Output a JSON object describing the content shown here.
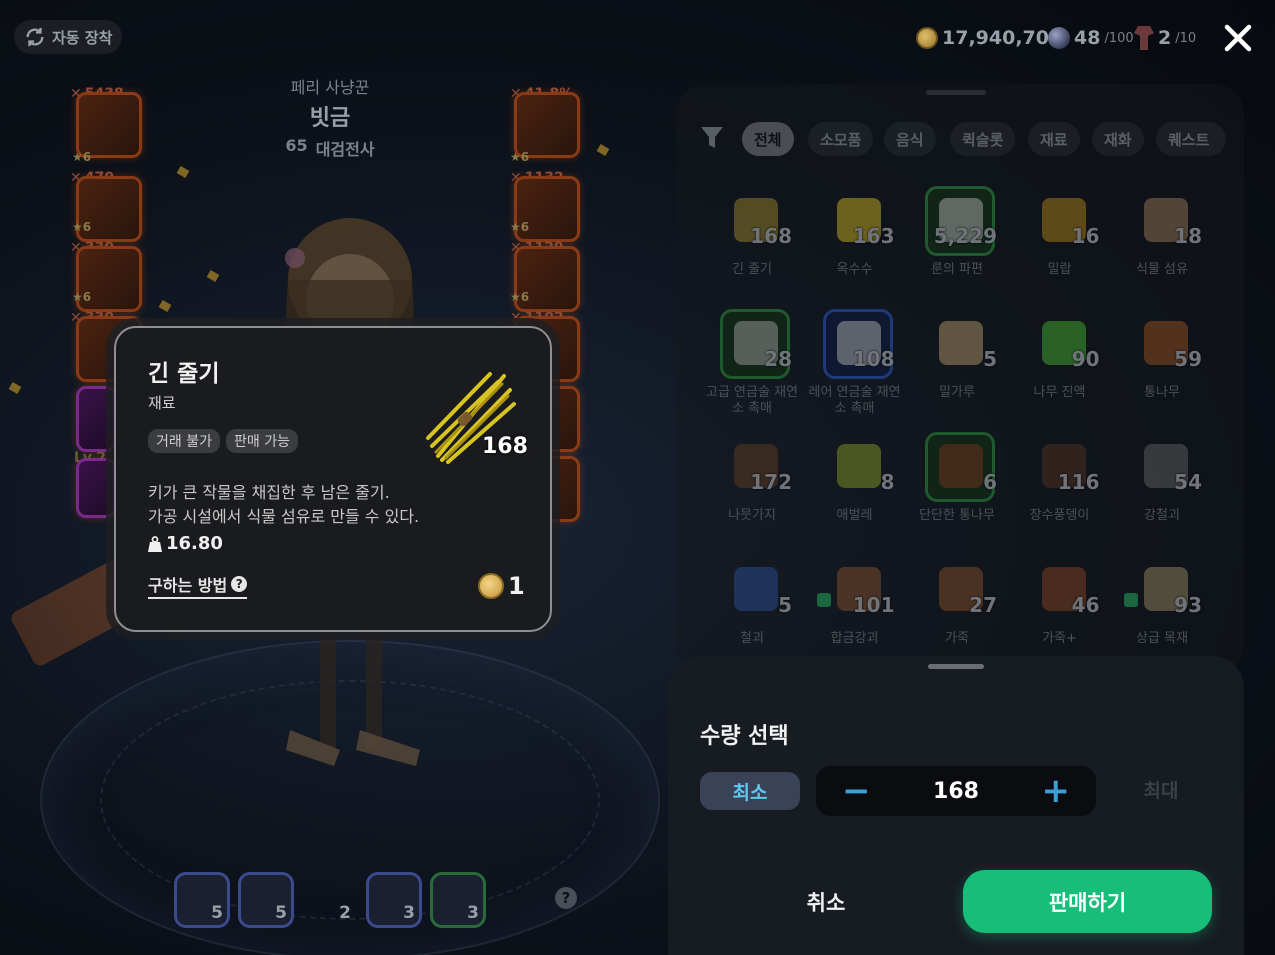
{
  "top_bar": {
    "auto_equip_label": "자동 장착",
    "gold": "17,940,704",
    "orb_count": "48",
    "orb_max": "/100",
    "totem_count": "2",
    "totem_max": "/10"
  },
  "character": {
    "title": "페리 사냥꾼",
    "name": "빗금",
    "level": "65",
    "class": "대검전사"
  },
  "equipment_left": [
    {
      "stat": "5438",
      "stars": "★6"
    },
    {
      "stat": "470",
      "stars": "★6"
    },
    {
      "stat": "330",
      "stars": "★6"
    },
    {
      "stat": "330",
      "stars": "★6"
    }
  ],
  "equipment_right": [
    {
      "stat": "41.8%",
      "stars": "★6"
    },
    {
      "stat": "1132",
      "stars": "★6"
    },
    {
      "stat": "1129",
      "stars": "★6"
    },
    {
      "stat": "1102",
      "stars": ""
    }
  ],
  "level_badge": "Lv.2",
  "quick_slots": [
    {
      "count": "5",
      "icon": "potion-red-icon"
    },
    {
      "count": "5",
      "icon": "cup-icon"
    },
    {
      "count": "2",
      "icon": "potion-purple-icon"
    },
    {
      "count": "3",
      "icon": "drink-icon"
    },
    {
      "count": "3",
      "icon": "pepper-icon"
    }
  ],
  "tooltip": {
    "name": "긴 줄기",
    "type": "재료",
    "tags": [
      "거래 불가",
      "판매 가능"
    ],
    "description_line1": "키가 큰 작물을 채집한 후 남은 줄기.",
    "description_line2": "가공 시설에서 식물 섬유로 만들 수 있다.",
    "weight": "16.80",
    "how_to_get": "구하는 방법",
    "count": "168",
    "price": "1"
  },
  "inventory": {
    "tabs": [
      "전체",
      "소모품",
      "음식",
      "퀵슬롯",
      "재료",
      "재화",
      "퀘스트"
    ],
    "active_tab": "전체",
    "items": [
      {
        "count": "168",
        "label": "긴 줄기",
        "frame": "",
        "color": "#8a7a2a"
      },
      {
        "count": "163",
        "label": "옥수수",
        "frame": "",
        "color": "#b8a020"
      },
      {
        "count": "5,229",
        "label": "룬의 파편",
        "frame": "green",
        "color": "#a0a0a0"
      },
      {
        "count": "16",
        "label": "밀랍",
        "frame": "",
        "color": "#a07818"
      },
      {
        "count": "18",
        "label": "식물 섬유",
        "frame": "",
        "color": "#8a7050"
      },
      {
        "count": "28",
        "label": "고급 연금술 재연소 촉매",
        "frame": "green",
        "color": "#909090"
      },
      {
        "count": "108",
        "label": "레어 연금술 재연소 촉매",
        "frame": "blue",
        "color": "#a0a0a0"
      },
      {
        "count": "5",
        "label": "밀가루",
        "frame": "",
        "color": "#a08a60"
      },
      {
        "count": "90",
        "label": "나무 진액",
        "frame": "",
        "color": "#40a030"
      },
      {
        "count": "59",
        "label": "통나무",
        "frame": "",
        "color": "#8a4a20"
      },
      {
        "count": "172",
        "label": "나뭇가지",
        "frame": "",
        "color": "#5a3a20"
      },
      {
        "count": "8",
        "label": "애벌레",
        "frame": "",
        "color": "#7a8a20"
      },
      {
        "count": "6",
        "label": "단단한 통나무",
        "frame": "green",
        "color": "#6a3018"
      },
      {
        "count": "116",
        "label": "장수풍뎅이",
        "frame": "",
        "color": "#4a3020"
      },
      {
        "count": "54",
        "label": "강철괴",
        "frame": "",
        "color": "#5a5a5a"
      },
      {
        "count": "5",
        "label": "철괴",
        "frame": "",
        "color": "#2a4a8a",
        "bag": false
      },
      {
        "count": "101",
        "label": "합금강괴",
        "frame": "",
        "color": "#7a4a2a",
        "bag": true
      },
      {
        "count": "27",
        "label": "가죽",
        "frame": "",
        "color": "#7a4a28",
        "bag": false
      },
      {
        "count": "46",
        "label": "가죽+",
        "frame": "",
        "color": "#7a4020",
        "bag": false
      },
      {
        "count": "93",
        "label": "상급 목재",
        "frame": "",
        "color": "#8a7a5a",
        "bag": true
      }
    ]
  },
  "quantity_sheet": {
    "title": "수량 선택",
    "min_label": "최소",
    "max_label": "최대",
    "value": "168",
    "minus": "−",
    "plus": "+",
    "cancel_label": "취소",
    "sell_label": "판매하기"
  },
  "colors": {
    "sell_button": "#17bd78",
    "stepper_accent": "#3aa0d8",
    "min_button_text": "#5ec8f0"
  }
}
